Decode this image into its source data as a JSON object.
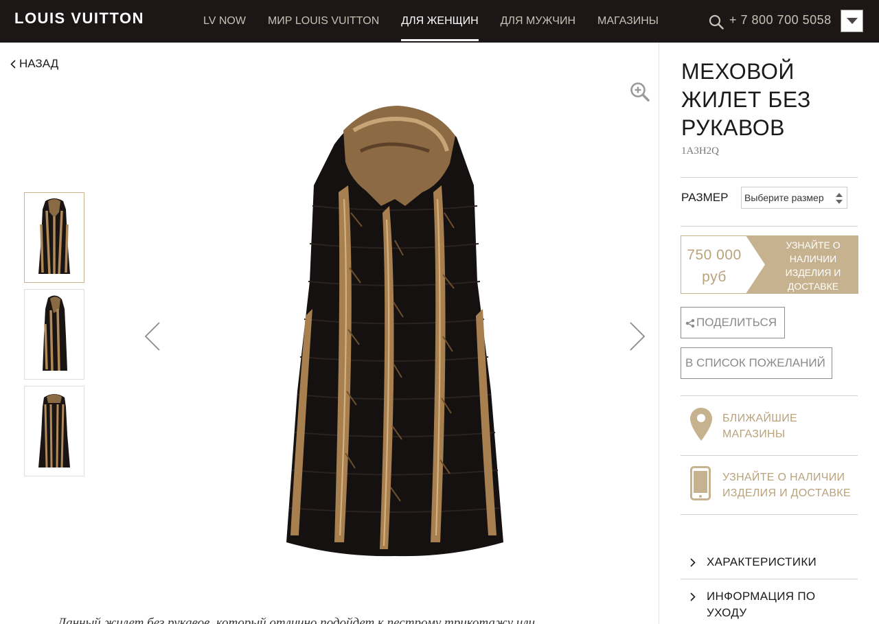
{
  "header": {
    "logo": "LOUIS VUITTON",
    "nav": [
      {
        "label": "LV NOW"
      },
      {
        "label": "МИР LOUIS VUITTON"
      },
      {
        "label": "ДЛЯ ЖЕНЩИН",
        "active": true
      },
      {
        "label": "ДЛЯ МУЖЧИН"
      },
      {
        "label": "МАГАЗИНЫ"
      }
    ],
    "phone": "+ 7 800 700 5058"
  },
  "gallery": {
    "back_label": "НАЗАД",
    "thumbnails": 3,
    "selected_index": 0,
    "description": "Данный жилет без рукавов, который отлично подойдет к пестрому трикотажу или"
  },
  "product": {
    "title": "МЕХОВОЙ ЖИЛЕТ БЕЗ РУКАВОВ",
    "code": "1A3H2Q",
    "size_label": "РАЗМЕР",
    "size_placeholder": "Выберите размер",
    "price_amount": "750 000",
    "price_currency": "руб",
    "availability_cta": "УЗНАЙТЕ О НАЛИЧИИ ИЗДЕЛИЯ И ДОСТАВКЕ",
    "share_label": "ПОДЕЛИТЬСЯ",
    "wishlist_label": "В СПИСОК ПОЖЕЛАНИЙ"
  },
  "services": [
    {
      "label": "БЛИЖАЙШИЕ МАГАЗИНЫ",
      "icon": "map-pin-icon"
    },
    {
      "label": "УЗНАЙТЕ О НАЛИЧИИ ИЗДЕЛИЯ И ДОСТАВКЕ",
      "icon": "phone-icon"
    }
  ],
  "accordions": [
    {
      "label": "ХАРАКТЕРИСТИКИ"
    },
    {
      "label": "ИНФОРМАЦИЯ ПО УХОДУ"
    }
  ],
  "colors": {
    "header_bg": "#1c1616",
    "gold": "#b9a27c",
    "gold_fill": "#c6b28f"
  }
}
